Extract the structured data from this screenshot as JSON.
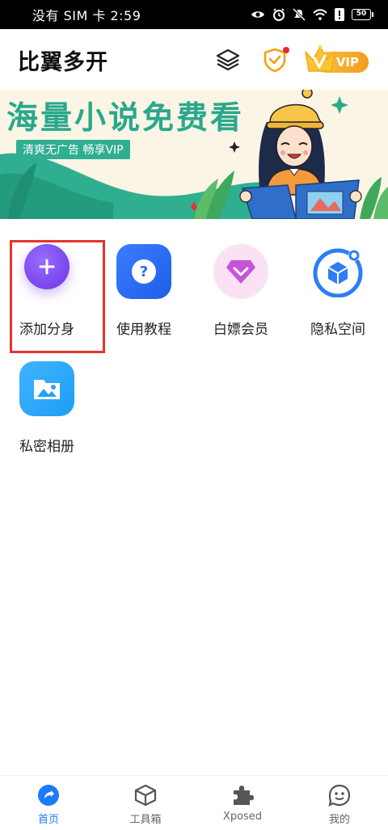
{
  "status_bar": {
    "carrier_time": "没有 SIM 卡 2:59",
    "battery_level": "50",
    "icons": [
      "eye-icon",
      "alarm-icon",
      "mute-icon",
      "wifi-icon",
      "alert-icon",
      "battery-icon"
    ]
  },
  "header": {
    "title": "比翼多开",
    "vip_label": "VIP",
    "has_notification_dot": true
  },
  "banner": {
    "title": "海量小说免费看",
    "subtitle": "清爽无广告 畅享VIP"
  },
  "features": [
    {
      "label": "添加分身",
      "icon": "plus-icon",
      "highlighted": true
    },
    {
      "label": "使用教程",
      "icon": "question-icon",
      "highlighted": false
    },
    {
      "label": "白嫖会员",
      "icon": "diamond-icon",
      "highlighted": false
    },
    {
      "label": "隐私空间",
      "icon": "privacy-cube-icon",
      "highlighted": false
    },
    {
      "label": "私密相册",
      "icon": "photo-album-icon",
      "highlighted": false
    }
  ],
  "bottom_nav": {
    "items": [
      {
        "label": "首页",
        "icon": "home-icon",
        "active": true
      },
      {
        "label": "工具箱",
        "icon": "toolbox-cube-icon",
        "active": false
      },
      {
        "label": "Xposed",
        "icon": "puzzle-icon",
        "active": false
      },
      {
        "label": "我的",
        "icon": "profile-face-icon",
        "active": false
      }
    ]
  },
  "colors": {
    "accent": "#1a7bff",
    "banner_green": "#2aa88b",
    "highlight_border": "#e5342f",
    "vip_gold": "#f8c33a"
  }
}
